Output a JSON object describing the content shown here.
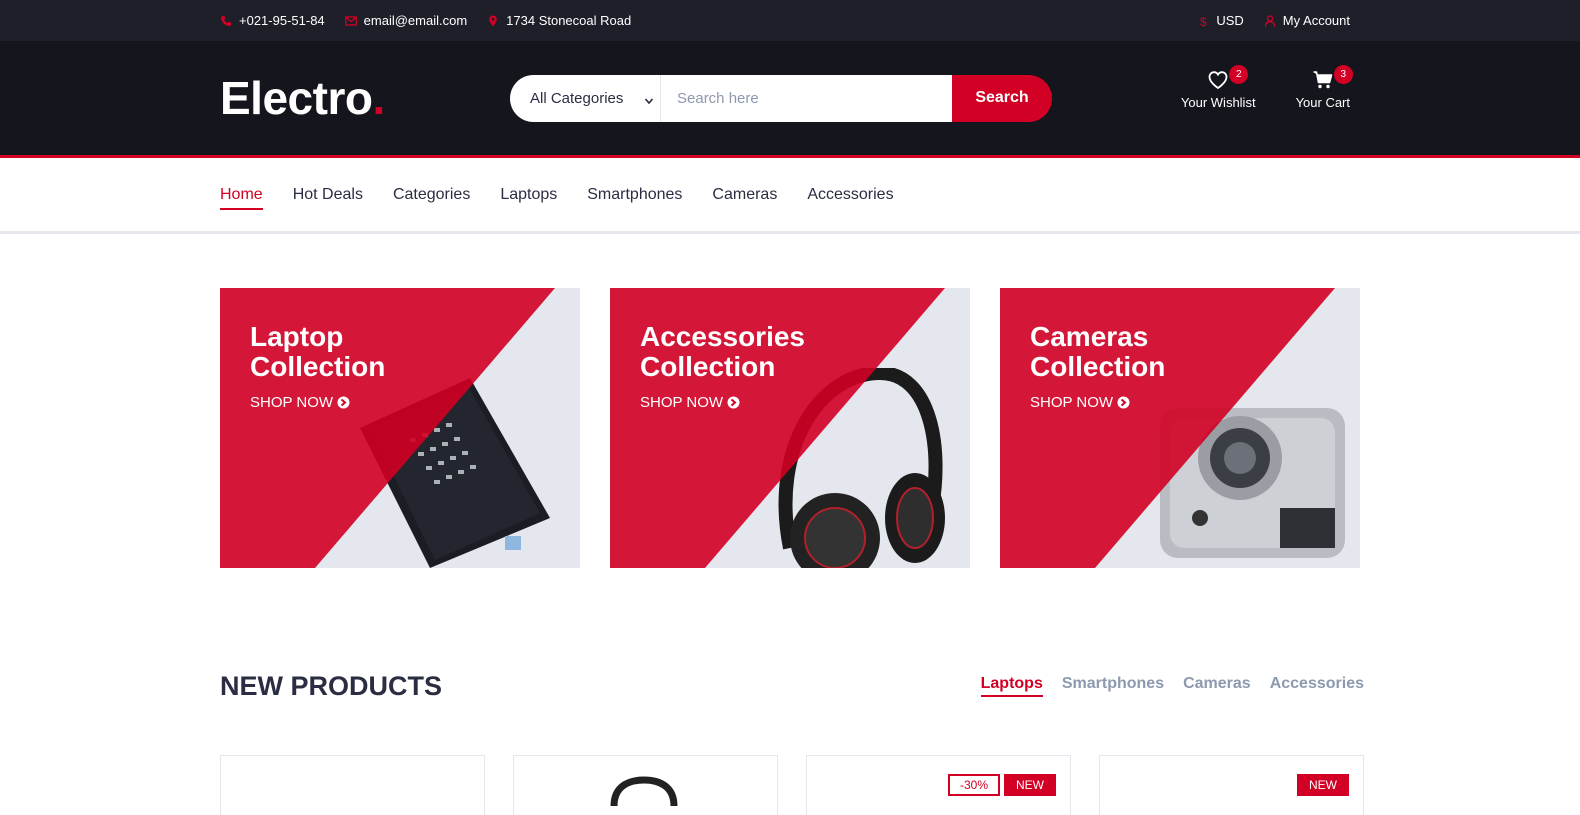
{
  "topbar": {
    "phone": "+021-95-51-84",
    "email": "email@email.com",
    "address": "1734 Stonecoal Road",
    "currency": "USD",
    "account": "My Account"
  },
  "header": {
    "logo": "Electro",
    "logo_dot": ".",
    "category_select": "All Categories",
    "search_placeholder": "Search here",
    "search_button": "Search",
    "wishlist_label": "Your Wishlist",
    "wishlist_count": "2",
    "cart_label": "Your Cart",
    "cart_count": "3"
  },
  "nav": [
    "Home",
    "Hot Deals",
    "Categories",
    "Laptops",
    "Smartphones",
    "Cameras",
    "Accessories"
  ],
  "collections": [
    {
      "title_line1": "Laptop",
      "title_line2": "Collection",
      "cta": "SHOP NOW",
      "icon": "laptop-image"
    },
    {
      "title_line1": "Accessories",
      "title_line2": "Collection",
      "cta": "SHOP NOW",
      "icon": "headphones-image"
    },
    {
      "title_line1": "Cameras",
      "title_line2": "Collection",
      "cta": "SHOP NOW",
      "icon": "camera-image"
    }
  ],
  "new_products": {
    "title": "NEW PRODUCTS",
    "tabs": [
      "Laptops",
      "Smartphones",
      "Cameras",
      "Accessories"
    ],
    "cards": [
      {
        "labels": []
      },
      {
        "labels": []
      },
      {
        "sale": "-30%",
        "new": "NEW"
      },
      {
        "new": "NEW"
      }
    ]
  },
  "colors": {
    "accent": "#D10024",
    "topbar_bg": "#1E1F29",
    "header_bg": "#15161D",
    "muted": "#8D99AE",
    "card_bg": "#E4E7ED"
  }
}
